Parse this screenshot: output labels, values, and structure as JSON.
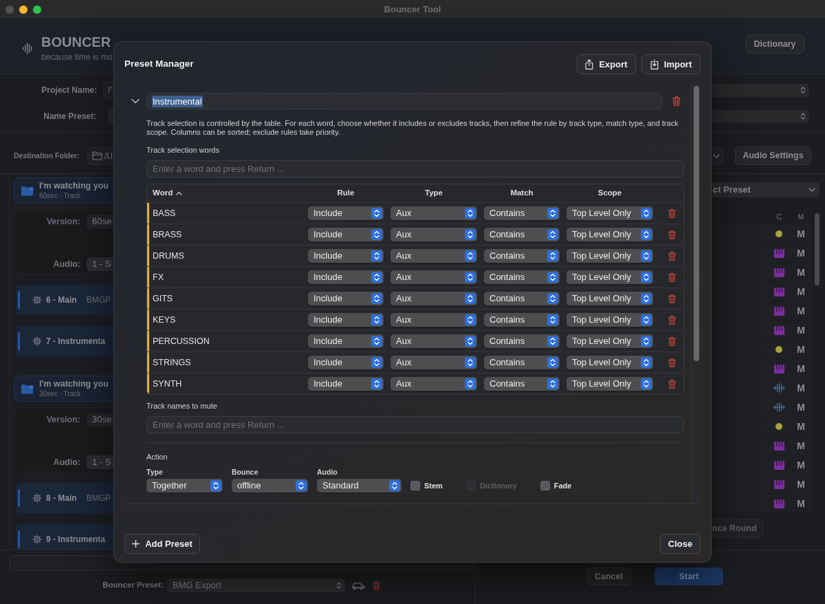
{
  "window": {
    "title": "Bouncer Tool"
  },
  "app_header": {
    "title": "BOUNCER",
    "subtitle": "because time is mo",
    "dictionary_button": "Dictionary"
  },
  "project": {
    "name_label": "Project Name:",
    "name_value": "I'",
    "preset_label": "Name Preset:"
  },
  "destination": {
    "label": "Destination Folder:",
    "path": "/U",
    "audio_settings_button": "Audio Settings"
  },
  "track_groups": [
    {
      "title": "I'm watching you",
      "subtitle": "60sec · Track",
      "version_label": "Version:",
      "version": "60se",
      "audio_label": "Audio:",
      "audio": "1 - S",
      "items": [
        {
          "title": "6 - Main",
          "detail": "BMGP"
        },
        {
          "title": "7 - Instrumenta"
        }
      ]
    },
    {
      "title": "I'm watching you",
      "subtitle": "30sec · Track",
      "version_label": "Version:",
      "version": "30se",
      "audio_label": "Audio:",
      "audio": "1 - S",
      "items": [
        {
          "title": "8 - Main",
          "detail": "BMGP"
        },
        {
          "title": "9 - Instrumenta"
        }
      ]
    }
  ],
  "track_list": {
    "preset_select": "ct Preset",
    "columns": [
      "C",
      "M"
    ],
    "rows": [
      {
        "kind": "dot",
        "mute": "M"
      },
      {
        "kind": "keys",
        "mute": "M"
      },
      {
        "kind": "keys",
        "mute": "M"
      },
      {
        "kind": "keys",
        "mute": "M"
      },
      {
        "kind": "keys",
        "mute": "M"
      },
      {
        "kind": "keys",
        "mute": "M"
      },
      {
        "kind": "dot",
        "mute": "M"
      },
      {
        "kind": "keys",
        "mute": "M"
      },
      {
        "kind": "wave",
        "mute": "M"
      },
      {
        "kind": "wave",
        "mute": "M"
      },
      {
        "kind": "dot",
        "mute": "M"
      },
      {
        "kind": "keys",
        "mute": "M"
      },
      {
        "kind": "keys",
        "mute": "M"
      },
      {
        "kind": "keys",
        "mute": "M"
      },
      {
        "kind": "keys",
        "mute": "M"
      }
    ],
    "round_button": "nce Round"
  },
  "footer": {
    "preset_label": "Bouncer Preset:",
    "preset_value": "BMG Export",
    "cancel_button": "Cancel",
    "start_button": "Start"
  },
  "preset_manager": {
    "title": "Preset Manager",
    "header_buttons": [
      {
        "kind": "export",
        "label": "Export"
      },
      {
        "kind": "import",
        "label": "Import"
      }
    ],
    "preset": {
      "expanded": true,
      "name": "Instrumental",
      "name_selected": true,
      "description": "Track selection is controlled by the table. For each word, choose whether it includes or excludes tracks, then refine the rule by track type, match type, and track scope. Columns can be sorted; exclude rules take priority.",
      "words_label": "Track selection words",
      "words_placeholder": "Enter a word and press Return ...",
      "table": {
        "columns": [
          {
            "label": "Word",
            "sorted": true
          },
          {
            "label": "Rule",
            "sorted": false
          },
          {
            "label": "Type",
            "sorted": false
          },
          {
            "label": "Match",
            "sorted": false
          },
          {
            "label": "Scope",
            "sorted": false
          }
        ],
        "rows": [
          {
            "word": "BASS",
            "rule": "Include",
            "type": "Aux",
            "match": "Contains",
            "scope": "Top Level Only"
          },
          {
            "word": "BRASS",
            "rule": "Include",
            "type": "Aux",
            "match": "Contains",
            "scope": "Top Level Only"
          },
          {
            "word": "DRUMS",
            "rule": "Include",
            "type": "Aux",
            "match": "Contains",
            "scope": "Top Level Only"
          },
          {
            "word": "FX",
            "rule": "Include",
            "type": "Aux",
            "match": "Contains",
            "scope": "Top Level Only"
          },
          {
            "word": "GITS",
            "rule": "Include",
            "type": "Aux",
            "match": "Contains",
            "scope": "Top Level Only"
          },
          {
            "word": "KEYS",
            "rule": "Include",
            "type": "Aux",
            "match": "Contains",
            "scope": "Top Level Only"
          },
          {
            "word": "PERCUSSION",
            "rule": "Include",
            "type": "Aux",
            "match": "Contains",
            "scope": "Top Level Only"
          },
          {
            "word": "STRINGS",
            "rule": "Include",
            "type": "Aux",
            "match": "Contains",
            "scope": "Top Level Only"
          },
          {
            "word": "SYNTH",
            "rule": "Include",
            "type": "Aux",
            "match": "Contains",
            "scope": "Top Level Only"
          }
        ]
      },
      "mute_label": "Track names to mute",
      "mute_placeholder": "Enter a word and press Return ...",
      "action": {
        "label": "Action",
        "selects": [
          {
            "label": "Type",
            "value": "Together"
          },
          {
            "label": "Bounce",
            "value": "offline"
          },
          {
            "label": "Audio",
            "value": "Standard"
          }
        ],
        "checkboxes": [
          {
            "label": "Stem",
            "checked": false,
            "disabled": false
          },
          {
            "label": "Dictionary",
            "checked": false,
            "disabled": true
          },
          {
            "label": "Fade",
            "checked": false,
            "disabled": false
          }
        ]
      }
    },
    "add_button": "Add Preset",
    "close_button": "Close"
  }
}
